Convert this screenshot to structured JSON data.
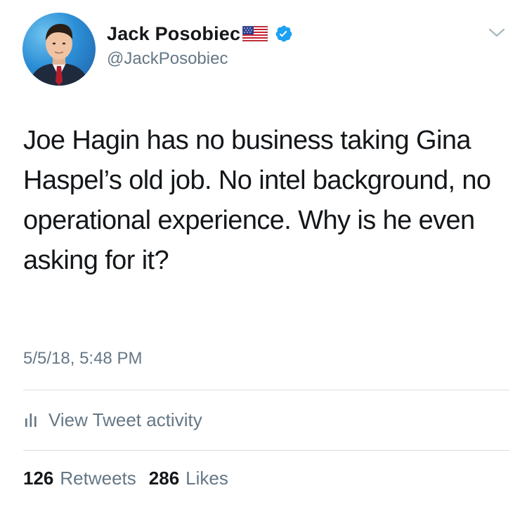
{
  "author": {
    "display_name": "Jack Posobiec",
    "handle": "@JackPosobiec",
    "flag_icon": "us-flag-icon",
    "verified_icon": "verified-badge-icon"
  },
  "tweet": {
    "text": "Joe Hagin has no business taking Gina Haspel’s old job. No intel background, no operational experience. Why is he even asking for it?",
    "timestamp": "5/5/18, 5:48 PM"
  },
  "activity": {
    "label": "View Tweet activity",
    "icon": "analytics-bars-icon"
  },
  "stats": {
    "retweets_count": "126",
    "retweets_label": "Retweets",
    "likes_count": "286",
    "likes_label": "Likes"
  },
  "colors": {
    "text_primary": "#14171a",
    "text_secondary": "#657786",
    "verified_blue": "#1da1f2",
    "divider": "#d8dde2"
  }
}
